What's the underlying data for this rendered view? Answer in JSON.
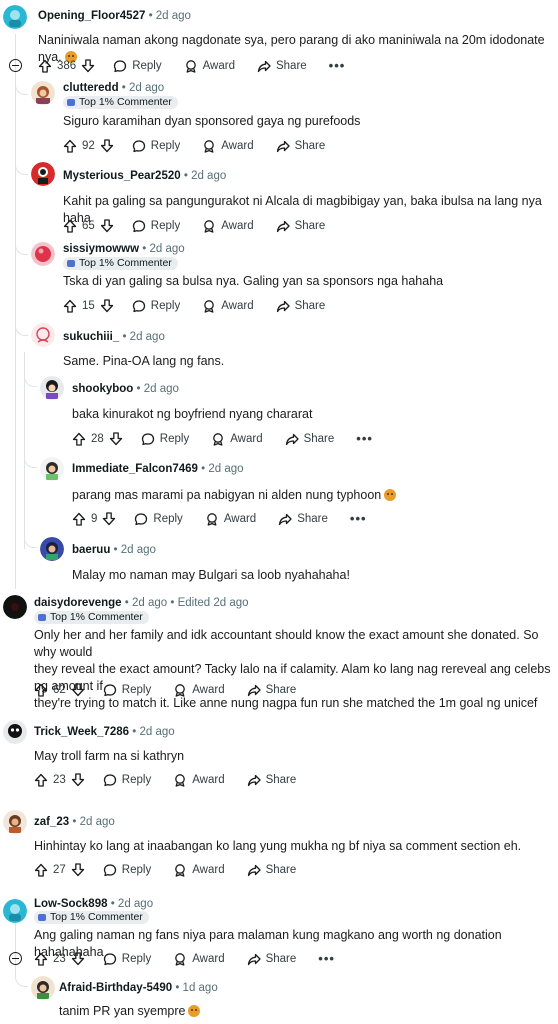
{
  "actions": {
    "reply": "Reply",
    "award": "Award",
    "share": "Share",
    "more": "•••"
  },
  "comments": [
    {
      "user": "Opening_Floor4527",
      "time": "• 2d ago",
      "text": "Naniniwala naman akong nagdonate sya, pero parang di ako maniniwala na 20m idodonate nya.",
      "votes": "386"
    },
    {
      "user": "clutteredd",
      "time": "• 2d ago",
      "badge": "Top 1% Commenter",
      "text": "Siguro karamihan dyan sponsored gaya ng purefoods",
      "votes": "92"
    },
    {
      "user": "Mysterious_Pear2520",
      "time": "• 2d ago",
      "text": "Kahit pa galing sa pangungurakot ni Alcala di magbibigay yan, baka ibulsa na lang nya haha",
      "votes": "65"
    },
    {
      "user": "sissiymowww",
      "time": "• 2d ago",
      "badge": "Top 1% Commenter",
      "text": "Tska di yan galing sa bulsa nya. Galing yan sa sponsors nga hahaha",
      "votes": "15"
    },
    {
      "user": "sukuchiii_",
      "time": "• 2d ago",
      "text": "Same. Pina-OA lang ng fans."
    },
    {
      "user": "shookyboo",
      "time": "• 2d ago",
      "text": "baka kinurakot ng boyfriend nyang chararat",
      "votes": "28"
    },
    {
      "user": "Immediate_Falcon7469",
      "time": "• 2d ago",
      "text": "parang mas marami pa nabigyan ni alden nung typhoon",
      "votes": "9"
    },
    {
      "user": "baeruu",
      "time": "• 2d ago",
      "text": "Malay mo naman may Bulgari sa loob nyahahaha!"
    },
    {
      "user": "daisydorevenge",
      "time": "• 2d ago • Edited 2d ago",
      "badge": "Top 1% Commenter",
      "text1": "Only her and her family and idk accountant should know the exact amount she donated. So why would",
      "text2": "they reveal the exact amount? Tacky lalo na if calamity. Alam ko lang nag rereveal ang celebs ng amount if",
      "text3": "they're trying to match it. Like anne nung nagpa fun run she matched the 1m goal ng unicef",
      "votes": "62"
    },
    {
      "user": "Trick_Week_7286",
      "time": "• 2d ago",
      "text": "May troll farm na si kathryn",
      "votes": "23"
    },
    {
      "user": "zaf_23",
      "time": "• 2d ago",
      "text": "Hinhintay ko lang at inaabangan ko lang yung mukha ng bf niya sa comment section eh.",
      "votes": "27"
    },
    {
      "user": "Low-Sock898",
      "time": "• 2d ago",
      "badge": "Top 1% Commenter",
      "text": "Ang galing naman ng fans niya para malaman kung magkano ang worth ng donation hahahahaha",
      "votes": "23"
    },
    {
      "user": "Afraid-Birthday-5490",
      "time": "• 1d ago",
      "text": "tanim PR yan syempre"
    }
  ]
}
